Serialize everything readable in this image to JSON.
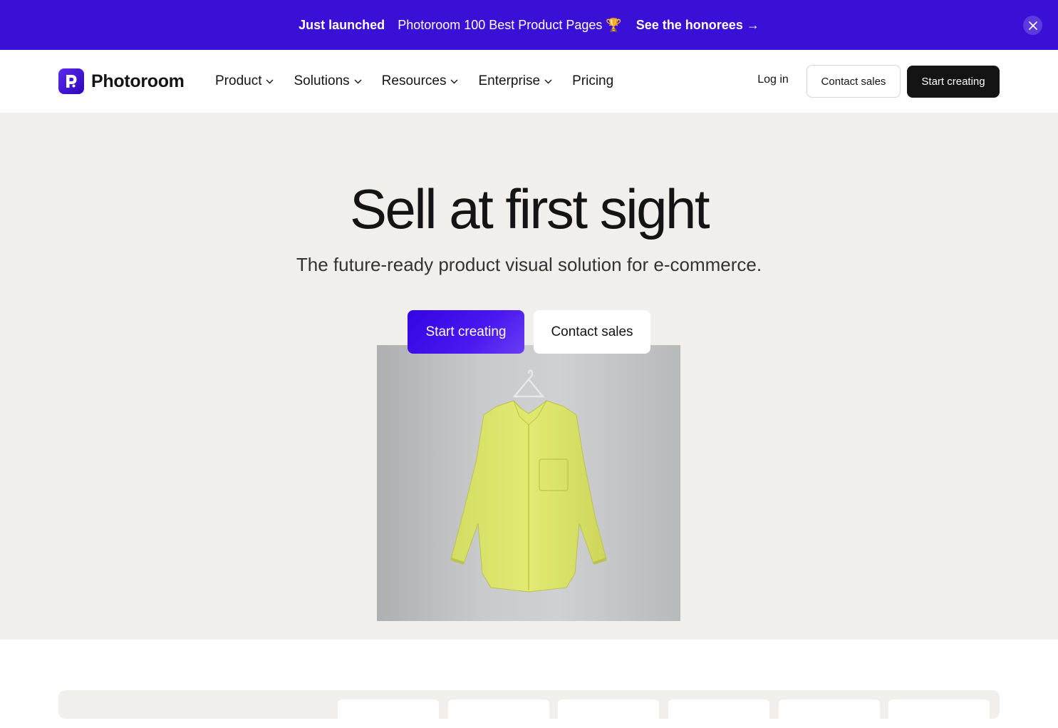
{
  "banner": {
    "label": "Just launched",
    "message": "Photoroom 100 Best Product Pages 🏆",
    "link": "See the honorees →",
    "close_icon": "close-icon",
    "background": "#3a0fd6"
  },
  "nav": {
    "brand": "Photoroom",
    "brand_color": "#3a0fd6",
    "menu": [
      {
        "label": "Product",
        "has_dropdown": true
      },
      {
        "label": "Solutions",
        "has_dropdown": true
      },
      {
        "label": "Resources",
        "has_dropdown": true
      },
      {
        "label": "Enterprise",
        "has_dropdown": true
      },
      {
        "label": "Pricing",
        "has_dropdown": false
      }
    ],
    "login": "Log in",
    "contact": "Contact sales",
    "start": "Start creating"
  },
  "hero": {
    "title": "Sell at first sight",
    "subtitle": "The future-ready product visual solution for e-commerce.",
    "primary_cta": "Start creating",
    "secondary_cta": "Contact sales",
    "primary_color": "#3a0fd6",
    "background": "#f0efec"
  }
}
